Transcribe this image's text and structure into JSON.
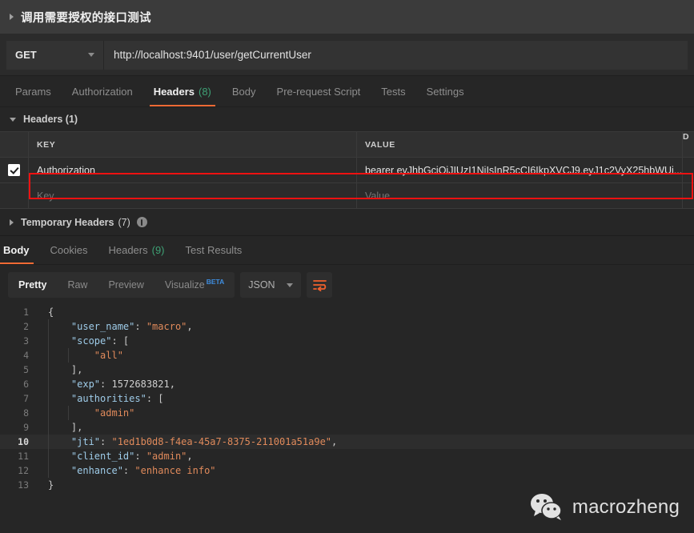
{
  "request": {
    "title": "调用需要授权的接口测试",
    "collapse_icon": "triangle-right-icon",
    "method": "GET",
    "url": "http://localhost:9401/user/getCurrentUser",
    "tabs": [
      {
        "label": "Params",
        "count": "",
        "active": false
      },
      {
        "label": "Authorization",
        "count": "",
        "active": false
      },
      {
        "label": "Headers",
        "count": "(8)",
        "active": true
      },
      {
        "label": "Body",
        "count": "",
        "active": false
      },
      {
        "label": "Pre-request Script",
        "count": "",
        "active": false
      },
      {
        "label": "Tests",
        "count": "",
        "active": false
      },
      {
        "label": "Settings",
        "count": "",
        "active": false
      }
    ]
  },
  "headers_section": {
    "label": "Headers (1)",
    "columns": {
      "key": "KEY",
      "value": "VALUE",
      "description": "D"
    },
    "rows": [
      {
        "checked": true,
        "key": "Authorization",
        "value": "bearer eyJhbGciOiJIUzI1NiIsInR5cCI6IkpXVCJ9.eyJ1c2VyX25hbWUi...",
        "highlighted": true
      },
      {
        "checked": false,
        "key": "Key",
        "value": "Value",
        "highlighted": false
      }
    ],
    "temporary": {
      "label": "Temporary Headers",
      "count": "(7)",
      "info_icon": "info-icon"
    }
  },
  "response": {
    "tabs": [
      {
        "label": "Body",
        "count": "",
        "active": true
      },
      {
        "label": "Cookies",
        "count": "",
        "active": false
      },
      {
        "label": "Headers",
        "count": "(9)",
        "active": false
      },
      {
        "label": "Test Results",
        "count": "",
        "active": false
      }
    ],
    "toolbar": {
      "formats": [
        {
          "label": "Pretty",
          "active": true,
          "badge": ""
        },
        {
          "label": "Raw",
          "active": false,
          "badge": ""
        },
        {
          "label": "Preview",
          "active": false,
          "badge": ""
        },
        {
          "label": "Visualize",
          "active": false,
          "badge": "BETA"
        }
      ],
      "language": "JSON",
      "wrap_icon": "word-wrap-icon"
    },
    "body_lines": [
      {
        "n": "1",
        "current": false,
        "tokens": [
          {
            "t": "p",
            "v": "{"
          }
        ]
      },
      {
        "n": "2",
        "current": false,
        "tokens": [
          {
            "t": "key",
            "v": "    \"user_name\""
          },
          {
            "t": "p",
            "v": ": "
          },
          {
            "t": "str",
            "v": "\"macro\""
          },
          {
            "t": "p",
            "v": ","
          }
        ]
      },
      {
        "n": "3",
        "current": false,
        "tokens": [
          {
            "t": "key",
            "v": "    \"scope\""
          },
          {
            "t": "p",
            "v": ": ["
          }
        ]
      },
      {
        "n": "4",
        "current": false,
        "tokens": [
          {
            "t": "str",
            "v": "        \"all\""
          }
        ]
      },
      {
        "n": "5",
        "current": false,
        "tokens": [
          {
            "t": "p",
            "v": "    ],"
          }
        ]
      },
      {
        "n": "6",
        "current": false,
        "tokens": [
          {
            "t": "key",
            "v": "    \"exp\""
          },
          {
            "t": "p",
            "v": ": "
          },
          {
            "t": "num",
            "v": "1572683821"
          },
          {
            "t": "p",
            "v": ","
          }
        ]
      },
      {
        "n": "7",
        "current": false,
        "tokens": [
          {
            "t": "key",
            "v": "    \"authorities\""
          },
          {
            "t": "p",
            "v": ": ["
          }
        ]
      },
      {
        "n": "8",
        "current": false,
        "tokens": [
          {
            "t": "str",
            "v": "        \"admin\""
          }
        ]
      },
      {
        "n": "9",
        "current": false,
        "tokens": [
          {
            "t": "p",
            "v": "    ],"
          }
        ]
      },
      {
        "n": "10",
        "current": true,
        "tokens": [
          {
            "t": "key",
            "v": "    \"jti\""
          },
          {
            "t": "p",
            "v": ": "
          },
          {
            "t": "str",
            "v": "\"1ed1b0d8-f4ea-45a7-8375-211001a51a9e\""
          },
          {
            "t": "p",
            "v": ","
          }
        ]
      },
      {
        "n": "11",
        "current": false,
        "tokens": [
          {
            "t": "key",
            "v": "    \"client_id\""
          },
          {
            "t": "p",
            "v": ": "
          },
          {
            "t": "str",
            "v": "\"admin\""
          },
          {
            "t": "p",
            "v": ","
          }
        ]
      },
      {
        "n": "12",
        "current": false,
        "tokens": [
          {
            "t": "key",
            "v": "    \"enhance\""
          },
          {
            "t": "p",
            "v": ": "
          },
          {
            "t": "str",
            "v": "\"enhance info\""
          }
        ]
      },
      {
        "n": "13",
        "current": false,
        "tokens": [
          {
            "t": "p",
            "v": "}"
          }
        ]
      }
    ]
  },
  "watermark": {
    "text": "macrozheng",
    "icon": "wechat-icon"
  },
  "colors": {
    "accent_orange": "#f06a34",
    "count_green": "#3ea175",
    "beta_blue": "#3f8ee0",
    "annotation_red": "#ee1111",
    "json_key": "#9ecbe8",
    "json_string": "#e08a5b"
  }
}
